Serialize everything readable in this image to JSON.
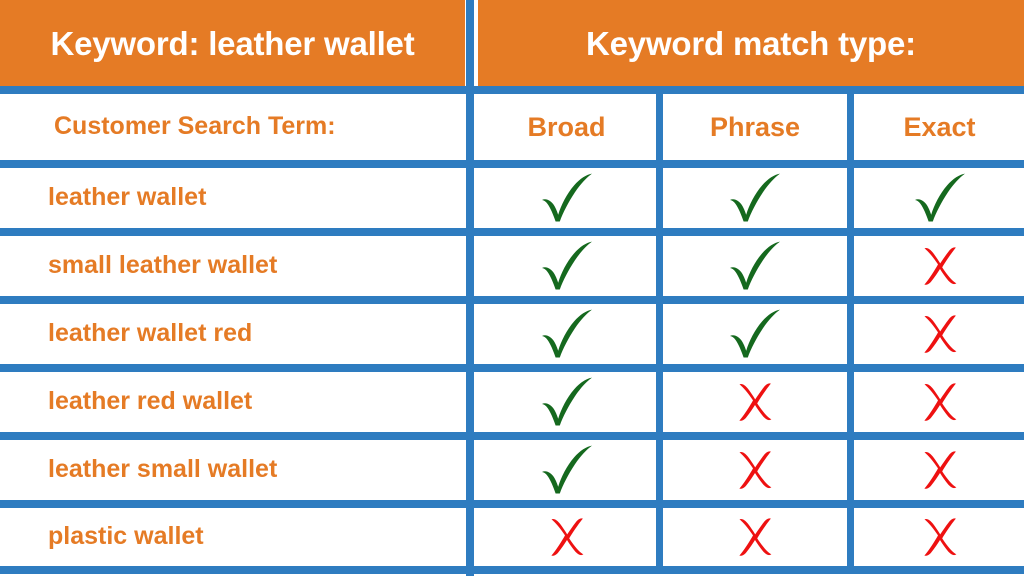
{
  "header": {
    "keyword_label": "Keyword: leather wallet",
    "match_type_label": "Keyword match type:"
  },
  "table": {
    "row_header_label": "Customer Search Term:",
    "columns": [
      "Broad",
      "Phrase",
      "Exact"
    ],
    "rows": [
      {
        "term": "leather wallet",
        "broad": "check",
        "phrase": "check",
        "exact": "check"
      },
      {
        "term": "small leather wallet",
        "broad": "check",
        "phrase": "check",
        "exact": "cross"
      },
      {
        "term": "leather wallet red",
        "broad": "check",
        "phrase": "check",
        "exact": "cross"
      },
      {
        "term": "leather red wallet",
        "broad": "check",
        "phrase": "cross",
        "exact": "cross"
      },
      {
        "term": "leather small wallet",
        "broad": "check",
        "phrase": "cross",
        "exact": "cross"
      },
      {
        "term": "plastic wallet",
        "broad": "cross",
        "phrase": "cross",
        "exact": "cross"
      }
    ]
  },
  "icons": {
    "check": "checkmark-icon",
    "cross": "cross-mark-icon"
  },
  "colors": {
    "header_orange": "#E57B25",
    "text_orange": "#E57B25",
    "grid_blue": "#2E7CC0",
    "check_green": "#15691E",
    "cross_red": "#EE1111",
    "header_text": "#FFFFFF",
    "background": "#FFFFFF"
  }
}
